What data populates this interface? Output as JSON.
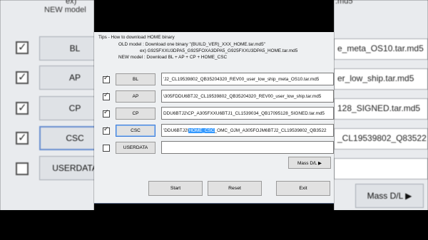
{
  "background": {
    "top_left_text": "ex)",
    "top_left_text2": "NEW model",
    "top_right_text": ".md5",
    "left_buttons": [
      "BL",
      "AP",
      "CP",
      "CSC",
      "USERDATA"
    ],
    "right_fields": [
      "e_meta_OS10.tar.md5",
      "er_low_ship.tar.md5",
      "128_SIGNED.tar.md5",
      "_CL19539802_Q83522",
      ""
    ],
    "right_mass_label": "Mass D/L ▶"
  },
  "tips": {
    "title": "Tips - How to download HOME binary",
    "line1": "OLD model : Download one binary    \"(BUILD_VER)_XXX_HOME.tar.md5\"",
    "line2": "ex) G925FXXU3DPA5_G925FOXA3DPA5_G925FXXU3DPA5_HOME.tar.md5",
    "line3": "NEW model : Download BL + AP + CP + HOME_CSC"
  },
  "rows": [
    {
      "label": "BL",
      "checked": true,
      "value": "'J2_CL19539802_QB35204320_REV00_user_low_ship_meta_OS10.tar.md5"
    },
    {
      "label": "AP",
      "checked": true,
      "value": "\\305FDDU6BTJ2_CL19539802_QB35204320_REV00_user_low_ship.tar.md5"
    },
    {
      "label": "CP",
      "checked": true,
      "value": "DDU6BTJ2\\CP_A305FXXU6BTJ1_CL1539034_QB17095128_SIGNED.tar.md5"
    },
    {
      "label": "CSC",
      "checked": true,
      "value_pre": "'DDU6BTJ2\\",
      "value_sel": "HOME_CSC",
      "value_post": "_OMC_OJM_A305FOJM6BTJ2_CL19539802_QB3522"
    },
    {
      "label": "USERDATA",
      "checked": false,
      "value": ""
    }
  ],
  "buttons": {
    "mass": "Mass D/L ▶",
    "start": "Start",
    "reset": "Reset",
    "exit": "Exit"
  }
}
